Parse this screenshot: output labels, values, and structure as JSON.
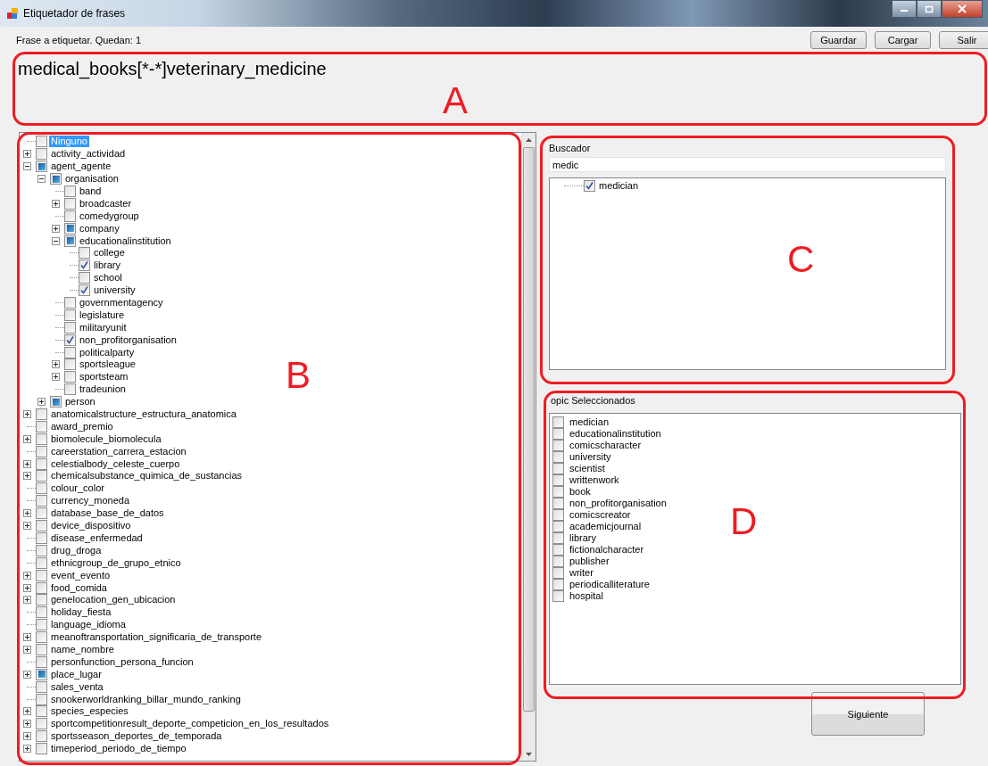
{
  "window": {
    "title": "Etiquetador de frases"
  },
  "status": "Frase a etiquetar. Quedan: 1",
  "buttons": [
    "Guardar",
    "Cargar",
    "Salir"
  ],
  "sentence": "medical_books[*-*]veterinary_medicine",
  "category_tree": {
    "items": [
      {
        "label": "Ninguno",
        "checked": false,
        "partial": false,
        "selected": true
      },
      {
        "label": "activity_actividad",
        "checked": false,
        "partial": false,
        "selected": false,
        "expanded": false
      },
      {
        "label": "agent_agente",
        "checked": false,
        "partial": true,
        "selected": false,
        "expanded": true,
        "children": [
          {
            "label": "organisation",
            "checked": false,
            "partial": true,
            "selected": false,
            "expanded": true,
            "children": [
              {
                "label": "band",
                "checked": false,
                "partial": false,
                "selected": false
              },
              {
                "label": "broadcaster",
                "checked": false,
                "partial": false,
                "selected": false,
                "expanded": false
              },
              {
                "label": "comedygroup",
                "checked": false,
                "partial": false,
                "selected": false
              },
              {
                "label": "company",
                "checked": false,
                "partial": true,
                "selected": false,
                "expanded": false
              },
              {
                "label": "educationalinstitution",
                "checked": false,
                "partial": true,
                "selected": false,
                "expanded": true,
                "children": [
                  {
                    "label": "college",
                    "checked": false,
                    "partial": false,
                    "selected": false
                  },
                  {
                    "label": "library",
                    "checked": true,
                    "selected": false
                  },
                  {
                    "label": "school",
                    "checked": false,
                    "partial": false,
                    "selected": false
                  },
                  {
                    "label": "university",
                    "checked": true,
                    "selected": false
                  }
                ]
              },
              {
                "label": "governmentagency",
                "checked": false,
                "partial": false,
                "selected": false
              },
              {
                "label": "legislature",
                "checked": false,
                "partial": false,
                "selected": false
              },
              {
                "label": "militaryunit",
                "checked": false,
                "partial": false,
                "selected": false
              },
              {
                "label": "non_profitorganisation",
                "checked": true,
                "selected": false
              },
              {
                "label": "politicalparty",
                "checked": false,
                "partial": false,
                "selected": false
              },
              {
                "label": "sportsleague",
                "checked": false,
                "partial": false,
                "selected": false,
                "expanded": false
              },
              {
                "label": "sportsteam",
                "checked": false,
                "partial": false,
                "selected": false,
                "expanded": false
              },
              {
                "label": "tradeunion",
                "checked": false,
                "partial": false,
                "selected": false
              }
            ]
          },
          {
            "label": "person",
            "checked": false,
            "partial": true,
            "selected": false,
            "expanded": false
          }
        ]
      },
      {
        "label": "anatomicalstructure_estructura_anatomica",
        "checked": false,
        "partial": false,
        "selected": false,
        "expanded": false
      },
      {
        "label": "award_premio",
        "checked": false,
        "partial": false,
        "selected": false
      },
      {
        "label": "biomolecule_biomolecula",
        "checked": false,
        "partial": false,
        "selected": false,
        "expanded": false
      },
      {
        "label": "careerstation_carrera_estacion",
        "checked": false,
        "partial": false,
        "selected": false
      },
      {
        "label": "celestialbody_celeste_cuerpo",
        "checked": false,
        "partial": false,
        "selected": false,
        "expanded": false
      },
      {
        "label": "chemicalsubstance_quimica_de_sustancias",
        "checked": false,
        "partial": false,
        "selected": false,
        "expanded": false
      },
      {
        "label": "colour_color",
        "checked": false,
        "partial": false,
        "selected": false
      },
      {
        "label": "currency_moneda",
        "checked": false,
        "partial": false,
        "selected": false
      },
      {
        "label": "database_base_de_datos",
        "checked": false,
        "partial": false,
        "selected": false,
        "expanded": false
      },
      {
        "label": "device_dispositivo",
        "checked": false,
        "partial": false,
        "selected": false,
        "expanded": false
      },
      {
        "label": "disease_enfermedad",
        "checked": false,
        "partial": false,
        "selected": false
      },
      {
        "label": "drug_droga",
        "checked": false,
        "partial": false,
        "selected": false
      },
      {
        "label": "ethnicgroup_de_grupo_etnico",
        "checked": false,
        "partial": false,
        "selected": false
      },
      {
        "label": "event_evento",
        "checked": false,
        "partial": false,
        "selected": false,
        "expanded": false
      },
      {
        "label": "food_comida",
        "checked": false,
        "partial": false,
        "selected": false,
        "expanded": false
      },
      {
        "label": "genelocation_gen_ubicacion",
        "checked": false,
        "partial": false,
        "selected": false,
        "expanded": false
      },
      {
        "label": "holiday_fiesta",
        "checked": false,
        "partial": false,
        "selected": false
      },
      {
        "label": "language_idioma",
        "checked": false,
        "partial": false,
        "selected": false
      },
      {
        "label": "meanoftransportation_significaria_de_transporte",
        "checked": false,
        "partial": false,
        "selected": false,
        "expanded": false
      },
      {
        "label": "name_nombre",
        "checked": false,
        "partial": false,
        "selected": false,
        "expanded": false
      },
      {
        "label": "personfunction_persona_funcion",
        "checked": false,
        "partial": false,
        "selected": false
      },
      {
        "label": "place_lugar",
        "checked": false,
        "partial": true,
        "selected": false,
        "expanded": false
      },
      {
        "label": "sales_venta",
        "checked": false,
        "partial": false,
        "selected": false
      },
      {
        "label": "snookerworldranking_billar_mundo_ranking",
        "checked": false,
        "partial": false,
        "selected": false
      },
      {
        "label": "species_especies",
        "checked": false,
        "partial": false,
        "selected": false,
        "expanded": false
      },
      {
        "label": "sportcompetitionresult_deporte_competicion_en_los_resultados",
        "checked": false,
        "partial": false,
        "selected": false,
        "expanded": false
      },
      {
        "label": "sportsseason_deportes_de_temporada",
        "checked": false,
        "partial": false,
        "selected": false,
        "expanded": false
      },
      {
        "label": "timeperiod_periodo_de_tiempo",
        "checked": false,
        "partial": false,
        "selected": false,
        "expanded": false
      }
    ]
  },
  "search": {
    "label": "Buscador",
    "value": "medic",
    "results": [
      {
        "label": "medician",
        "checked": true,
        "selected": false
      }
    ]
  },
  "selected_topics": {
    "label": "opic Seleccionados",
    "items": [
      {
        "label": "medician",
        "checked": false
      },
      {
        "label": "educationalinstitution",
        "checked": false
      },
      {
        "label": "comicscharacter",
        "checked": false
      },
      {
        "label": "university",
        "checked": false
      },
      {
        "label": "scientist",
        "checked": false
      },
      {
        "label": "writtenwork",
        "checked": false
      },
      {
        "label": "book",
        "checked": false
      },
      {
        "label": "non_profitorganisation",
        "checked": false
      },
      {
        "label": "comicscreator",
        "checked": false
      },
      {
        "label": "academicjournal",
        "checked": false
      },
      {
        "label": "library",
        "checked": false
      },
      {
        "label": "fictionalcharacter",
        "checked": false
      },
      {
        "label": "publisher",
        "checked": false
      },
      {
        "label": "writer",
        "checked": false
      },
      {
        "label": "periodicalliterature",
        "checked": false
      },
      {
        "label": "hospital",
        "checked": false
      }
    ]
  },
  "next_button": "Siguiente",
  "annotations": [
    "A",
    "B",
    "C",
    "D"
  ]
}
